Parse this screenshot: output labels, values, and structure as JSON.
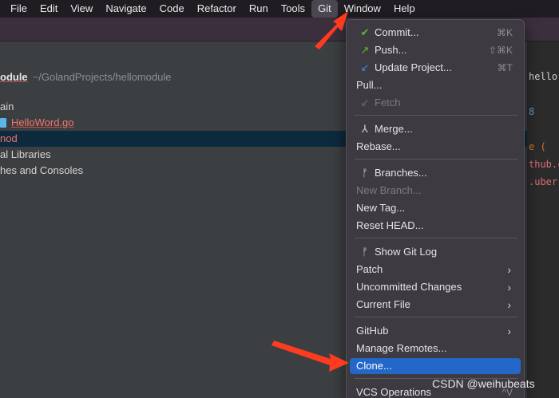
{
  "menubar": {
    "items": [
      "File",
      "Edit",
      "View",
      "Navigate",
      "Code",
      "Refactor",
      "Run",
      "Tools",
      "Git",
      "Window",
      "Help"
    ]
  },
  "project": {
    "name": "odule",
    "path": "~/GolandProjects/hellomodule",
    "rows": [
      "ain",
      "HelloWord.go",
      "nod",
      "al Libraries",
      "hes and Consoles"
    ]
  },
  "editor": {
    "fragments": [
      "hello",
      "8",
      "e (",
      "thub.c",
      ".uber."
    ]
  },
  "git_menu": {
    "commit": {
      "label": "Commit...",
      "shortcut": "⌘K"
    },
    "push": {
      "label": "Push...",
      "shortcut": "⇧⌘K"
    },
    "update": {
      "label": "Update Project...",
      "shortcut": "⌘T"
    },
    "pull": "Pull...",
    "fetch": "Fetch",
    "merge": "Merge...",
    "rebase": "Rebase...",
    "branches": "Branches...",
    "new_branch": "New Branch...",
    "new_tag": "New Tag...",
    "reset_head": "Reset HEAD...",
    "show_log": "Show Git Log",
    "patch": "Patch",
    "uncommitted": "Uncommitted Changes",
    "current_file": "Current File",
    "github": "GitHub",
    "manage_remotes": "Manage Remotes...",
    "clone": "Clone...",
    "vcs_ops": {
      "label": "VCS Operations",
      "shortcut": "^V"
    }
  },
  "watermark": "CSDN @weihubeats",
  "colors": {
    "highlight": "#2367c9",
    "arrow": "#ff3b1f",
    "commit_check": "#5fb832",
    "push_arrow": "#5fb832",
    "update_arrow": "#3a8ee6"
  }
}
